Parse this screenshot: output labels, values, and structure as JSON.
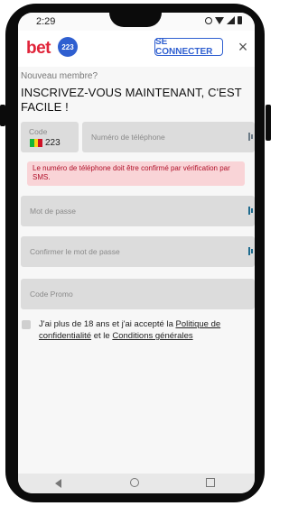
{
  "status_bar": {
    "time": "2:29",
    "icons": [
      "alarm-icon",
      "wifi-icon",
      "signal-icon",
      "battery-icon"
    ]
  },
  "header": {
    "logo_text": "bet",
    "logo_badge": "223",
    "connect_label": "SE CONNECTER",
    "close_icon": "close-icon",
    "close_glyph": "×"
  },
  "form": {
    "new_member": "Nouveau membre?",
    "title": "INSCRIVEZ-VOUS MAINTENANT, C'EST FACILE !",
    "country_code_label": "Code",
    "country_code_value": "223",
    "phone_placeholder": "Numéro de téléphone",
    "phone_error": "Le numéro de téléphone doit être confirmé par vérification par SMS.",
    "password_placeholder": "Mot de passe",
    "confirm_password_placeholder": "Confirmer le mot de passe",
    "promo_placeholder": "Code Promo",
    "terms_prefix": "J'ai plus de 18 ans et j'ai accepté la ",
    "privacy_link": "Politique de confidentialité",
    "terms_middle": " et le ",
    "conditions_link": "Conditions générales"
  },
  "colors": {
    "accent": "#2f5fd0",
    "error_bg": "#f9d4d7",
    "error_text": "#b0112a",
    "field_bg": "#dcdcdc",
    "logo_red": "#e0243a",
    "flag": [
      "#14b53a",
      "#fcd116",
      "#ce1126"
    ]
  },
  "nav_bar": {
    "icons": [
      "back-icon",
      "home-icon",
      "recent-apps-icon"
    ]
  }
}
